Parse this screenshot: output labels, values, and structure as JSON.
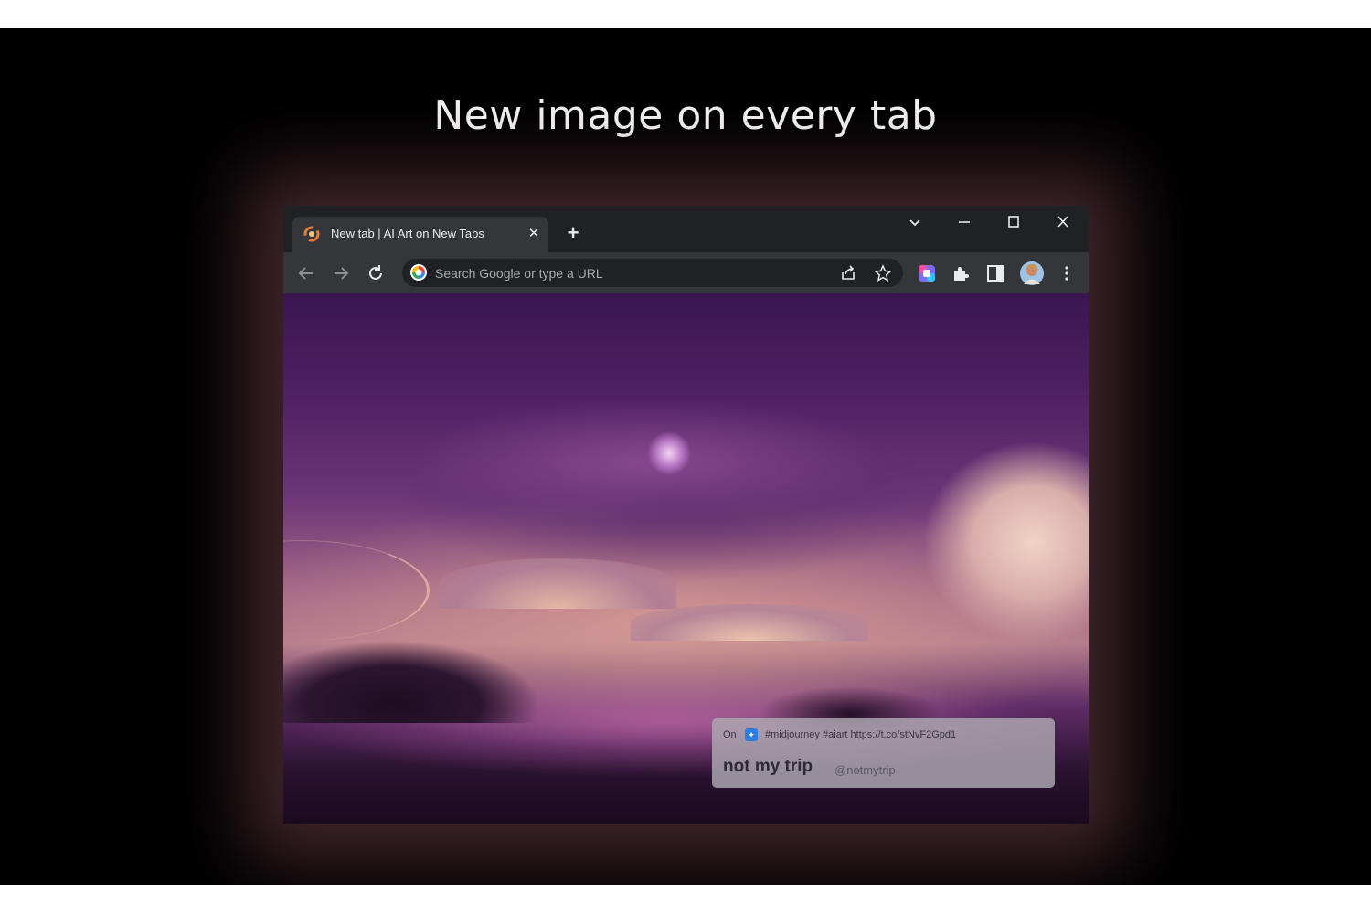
{
  "headline": "New image on every tab",
  "browser": {
    "tab": {
      "title": "New tab | AI Art on New Tabs",
      "close_symbol": "✕"
    },
    "new_tab_symbol": "+",
    "omnibox": {
      "placeholder": "Search Google or type a URL"
    },
    "icons": {
      "back": "arrow-left-icon",
      "forward": "arrow-right-icon",
      "reload": "reload-icon",
      "share": "share-icon",
      "bookmark": "star-icon",
      "extension_color": "color-extension-icon",
      "extensions": "puzzle-icon",
      "side_panel": "side-panel-icon",
      "profile": "avatar",
      "menu": "kebab-menu-icon"
    }
  },
  "image_credit": {
    "prefix": "On",
    "tweet_text": "#midjourney #aiart https://t.co/stNvF2Gpd1",
    "author_name": "not my trip",
    "author_handle": "@notmytrip"
  },
  "colors": {
    "page_background": "#000000",
    "browser_frame": "#202124",
    "toolbar": "#35363a",
    "accent_purple": "#6b3577"
  }
}
